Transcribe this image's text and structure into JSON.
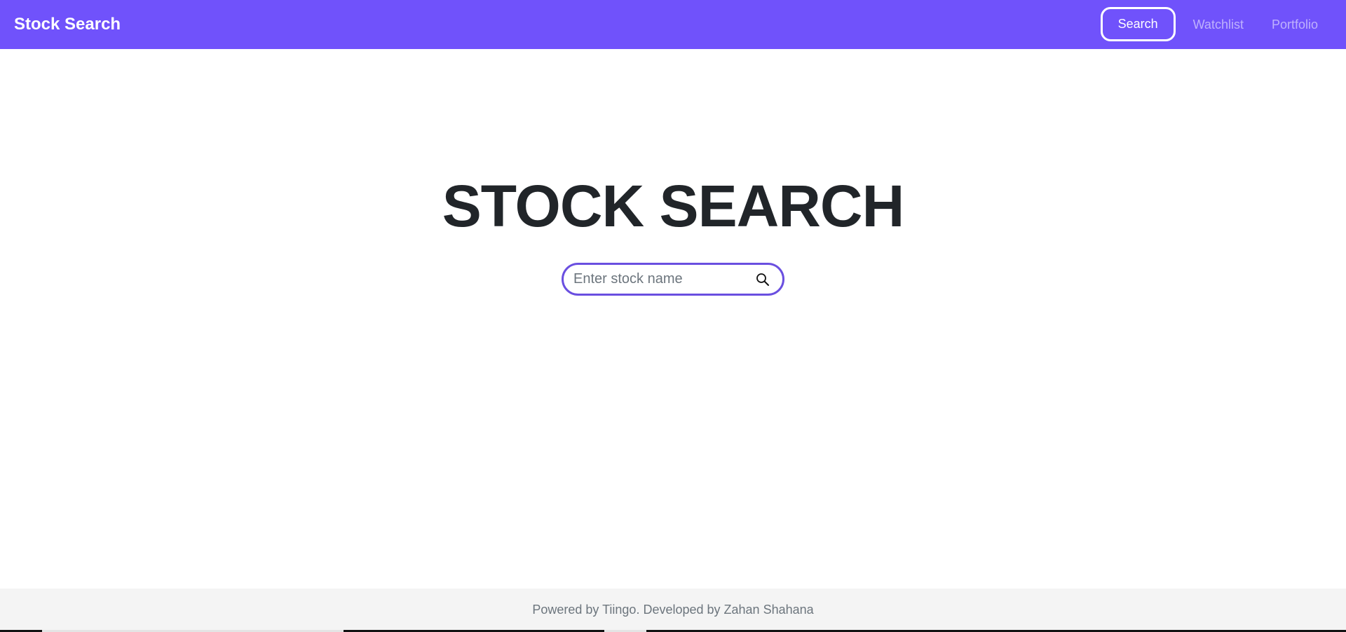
{
  "navbar": {
    "brand": "Stock Search",
    "links": [
      {
        "label": "Search",
        "active": true
      },
      {
        "label": "Watchlist",
        "active": false
      },
      {
        "label": "Portfolio",
        "active": false
      }
    ],
    "background_color": "#7052fb"
  },
  "main": {
    "title": "STOCK SEARCH",
    "search": {
      "placeholder": "Enter stock name",
      "value": "",
      "icon": "search-icon",
      "border_color": "#6a4fe0"
    }
  },
  "footer": {
    "text": "Powered by Tiingo. Developed by Zahan Shahana"
  }
}
